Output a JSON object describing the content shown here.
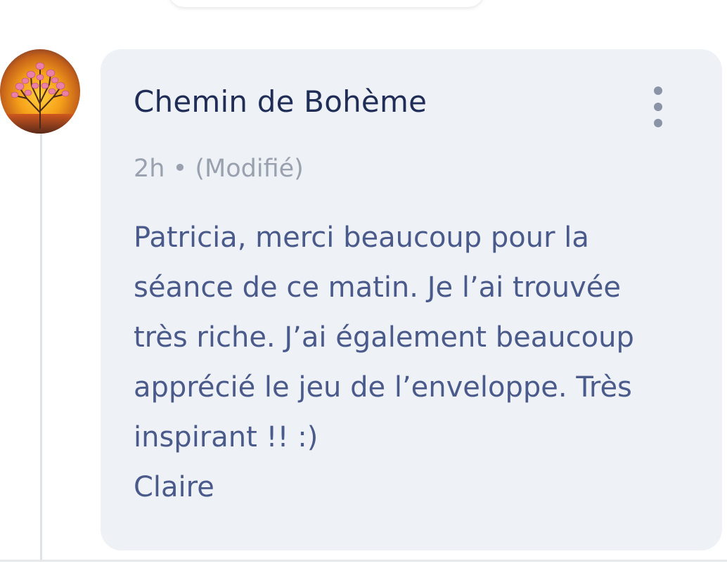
{
  "comment": {
    "author": "Chemin de Bohème",
    "timestamp": "2h",
    "separator": "•",
    "edited_label": "(Modifié)",
    "message": "Patricia, merci beaucoup pour la\nséance de ce matin. Je l’ai trouvée\ntrès riche. J’ai également beaucoup\napprécié le jeu de l’enveloppe. Très\ninspirant !! :)\nClaire",
    "more_icon": "more-vertical-icon",
    "avatar_icon": "magnolia-tree-sunset"
  },
  "colors": {
    "bubble_bg": "#eef1f5",
    "author": "#1f2d57",
    "meta": "#9aa1ae",
    "message": "#4a5a8a",
    "dots": "#8b94a6"
  }
}
